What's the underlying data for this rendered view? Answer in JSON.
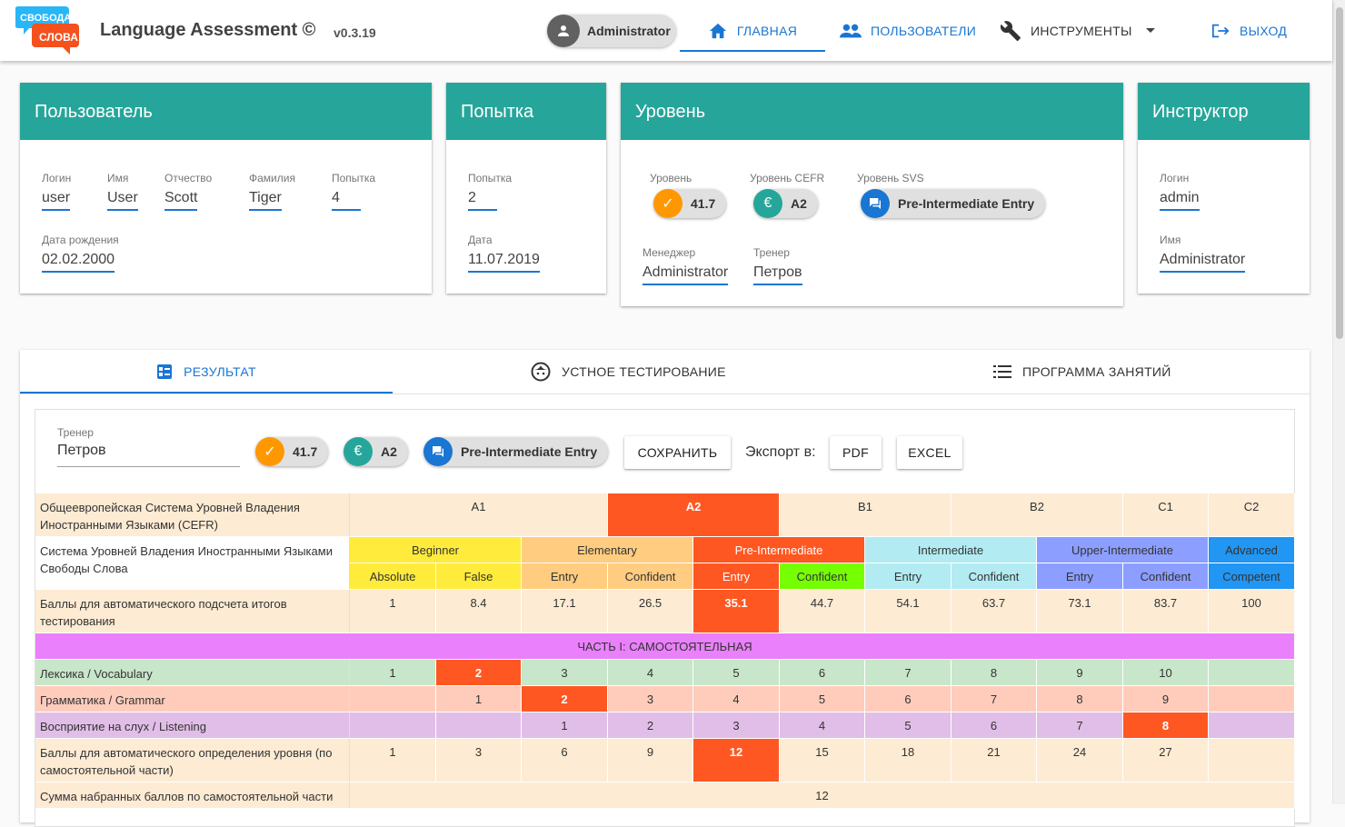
{
  "header": {
    "logo_line1": "СВОБОДА",
    "logo_line2": "СЛОВА",
    "app_title": "Language Assessment ©",
    "version": "v0.3.19",
    "user_chip": "Administrator",
    "nav": {
      "home": "ГЛАВНАЯ",
      "users": "ПОЛЬЗОВАТЕЛИ",
      "tools": "ИНСТРУМЕНТЫ",
      "exit": "ВЫХОД"
    }
  },
  "cards": {
    "user": {
      "title": "Пользователь",
      "login_label": "Логин",
      "login": "user",
      "name_label": "Имя",
      "name": "User",
      "patronymic_label": "Отчество",
      "patronymic": "Scott",
      "surname_label": "Фамилия",
      "surname": "Tiger",
      "attempt_label": "Попытка",
      "attempt": "4",
      "birth_label": "Дата рождения",
      "birth": "02.02.2000"
    },
    "attempt": {
      "title": "Попытка",
      "attempt_label": "Попытка",
      "attempt": "2",
      "date_label": "Дата",
      "date": "11.07.2019"
    },
    "level": {
      "title": "Уровень",
      "level_label": "Уровень",
      "level": "41.7",
      "cefr_label": "Уровень CEFR",
      "cefr": "A2",
      "svs_label": "Уровень SVS",
      "svs": "Pre-Intermediate Entry",
      "manager_label": "Менеджер",
      "manager": "Administrator",
      "trainer_label": "Тренер",
      "trainer": "Петров"
    },
    "instructor": {
      "title": "Инструктор",
      "login_label": "Логин",
      "login": "admin",
      "name_label": "Имя",
      "name": "Administrator"
    }
  },
  "tabs": {
    "result": "РЕЗУЛЬТАТ",
    "oral": "УСТНОЕ ТЕСТИРОВАНИЕ",
    "program": "ПРОГРАММА ЗАНЯТИЙ"
  },
  "result": {
    "trainer_label": "Тренер",
    "trainer": "Петров",
    "score": "41.7",
    "cefr": "A2",
    "svs": "Pre-Intermediate Entry",
    "save": "СОХРАНИТЬ",
    "export_label": "Экспорт в:",
    "pdf": "PDF",
    "excel": "EXCEL"
  },
  "colors": {
    "teal": "#26a69a",
    "primary": "#1976d2",
    "highlight": "#ff5722",
    "beige": "#fdebd3",
    "beginner": "#ffeb3b",
    "elementary": "#ffcc80",
    "pre_intermediate": "#ff5722",
    "pre_int_confident": "#76ff03",
    "intermediate": "#b2ebf2",
    "upper": "#8c9eff",
    "advanced": "#2196f3",
    "part": "#ea80fc",
    "vocab": "#c8e6c9",
    "grammar": "#ffccbc",
    "listening": "#e1bee7"
  },
  "table": {
    "cefr_row": {
      "label": "Общеевропейская Система Уровней Владения Иностранными Языками (CEFR)",
      "levels": [
        "A1",
        "A2",
        "B1",
        "B2",
        "C1",
        "C2"
      ]
    },
    "svs_row": {
      "label": "Система Уровней Владения Иностранными Языками Свободы Слова",
      "groups": [
        "Beginner",
        "Elementary",
        "Pre-Intermediate",
        "Intermediate",
        "Upper-Intermediate",
        "Advanced"
      ],
      "sublevels": [
        "Absolute",
        "False",
        "Entry",
        "Confident",
        "Entry",
        "Confident",
        "Entry",
        "Confident",
        "Entry",
        "Confident",
        "Competent"
      ]
    },
    "points_row": {
      "label": "Баллы для автоматического подсчета итогов тестирования",
      "values": [
        "1",
        "8.4",
        "17.1",
        "26.5",
        "35.1",
        "44.7",
        "54.1",
        "63.7",
        "73.1",
        "83.7",
        "100"
      ]
    },
    "part1_title": "ЧАСТЬ I: САМОСТОЯТЕЛЬНАЯ",
    "vocab_row": {
      "label": "Лексика / Vocabulary",
      "values": [
        "1",
        "2",
        "3",
        "4",
        "5",
        "6",
        "7",
        "8",
        "9",
        "10",
        ""
      ]
    },
    "grammar_row": {
      "label": "Грамматика / Grammar",
      "values": [
        "",
        "1",
        "2",
        "3",
        "4",
        "5",
        "6",
        "7",
        "8",
        "9",
        ""
      ]
    },
    "listening_row": {
      "label": "Восприятие на слух / Listening",
      "values": [
        "",
        "",
        "1",
        "2",
        "3",
        "4",
        "5",
        "6",
        "7",
        "8",
        ""
      ]
    },
    "auto_row": {
      "label": "Баллы для автоматического определения уровня (по самостоятельной части)",
      "values": [
        "1",
        "3",
        "6",
        "9",
        "12",
        "15",
        "18",
        "21",
        "24",
        "27",
        ""
      ]
    },
    "sum_row": {
      "label": "Сумма набранных баллов по самостоятельной части",
      "value": "12"
    }
  }
}
